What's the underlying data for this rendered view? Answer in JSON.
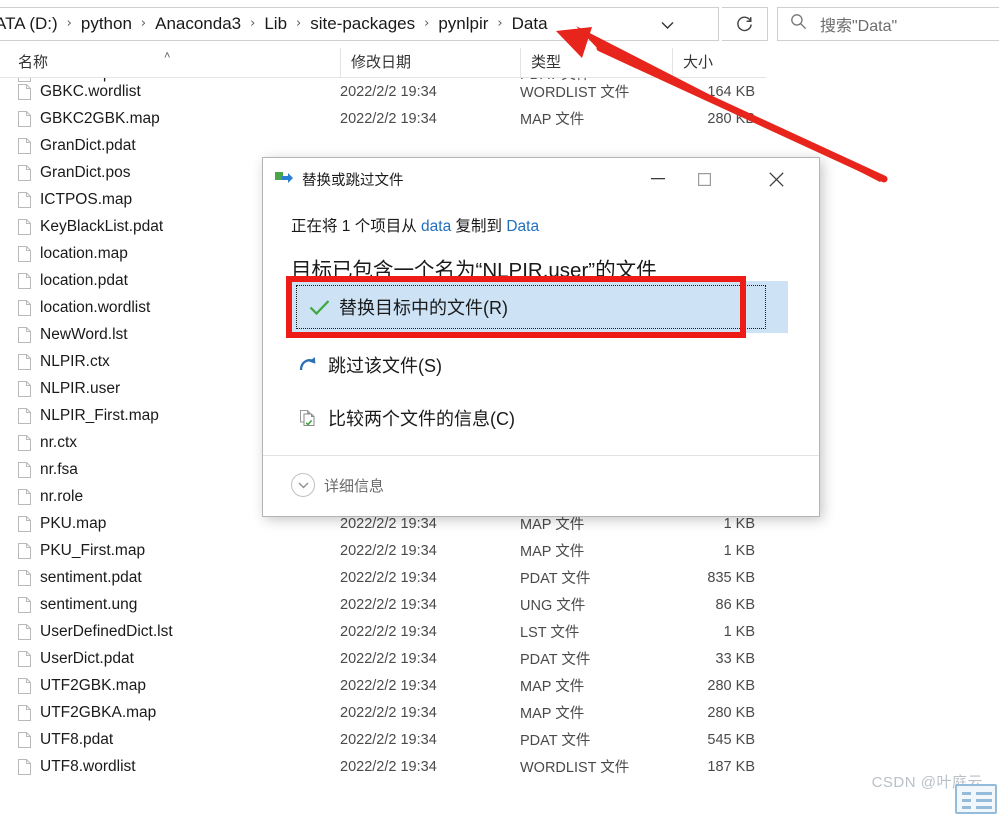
{
  "window": {
    "breadcrumb": {
      "crumbs": [
        "ATA (D:)",
        "python",
        "Anaconda3",
        "Lib",
        "site-packages",
        "pynlpir",
        "Data"
      ],
      "separator": "›",
      "dropdown_icon": "chevron-down-icon",
      "refresh_icon": "refresh-icon"
    },
    "search": {
      "icon": "search-icon",
      "placeholder": "搜索\"Data\""
    },
    "columns": [
      {
        "label": "名称",
        "sorted": true,
        "sort_caret": "˄"
      },
      {
        "label": "修改日期"
      },
      {
        "label": "类型"
      },
      {
        "label": "大小"
      }
    ]
  },
  "files": [
    {
      "name": "GBKC.wordlist",
      "date": "2022/2/2 19:34",
      "type": "WORDLIST 文件",
      "size": "164 KB"
    },
    {
      "name": "GBKC2GBK.map",
      "date": "2022/2/2 19:34",
      "type": "MAP 文件",
      "size": "280 KB"
    },
    {
      "name": "GranDict.pdat",
      "date": "",
      "type": "",
      "size": ""
    },
    {
      "name": "GranDict.pos",
      "date": "",
      "type": "",
      "size": ""
    },
    {
      "name": "ICTPOS.map",
      "date": "",
      "type": "",
      "size": ""
    },
    {
      "name": "KeyBlackList.pdat",
      "date": "",
      "type": "",
      "size": ""
    },
    {
      "name": "location.map",
      "date": "",
      "type": "",
      "size": ""
    },
    {
      "name": "location.pdat",
      "date": "",
      "type": "",
      "size": ""
    },
    {
      "name": "location.wordlist",
      "date": "",
      "type": "",
      "size": ""
    },
    {
      "name": "NewWord.lst",
      "date": "",
      "type": "",
      "size": ""
    },
    {
      "name": "NLPIR.ctx",
      "date": "",
      "type": "",
      "size": ""
    },
    {
      "name": "NLPIR.user",
      "date": "",
      "type": "",
      "size": ""
    },
    {
      "name": "NLPIR_First.map",
      "date": "",
      "type": "",
      "size": ""
    },
    {
      "name": "nr.ctx",
      "date": "",
      "type": "",
      "size": ""
    },
    {
      "name": "nr.fsa",
      "date": "",
      "type": "",
      "size": ""
    },
    {
      "name": "nr.role",
      "date": "",
      "type": "",
      "size": ""
    },
    {
      "name": "PKU.map",
      "date": "2022/2/2 19:34",
      "type": "MAP 文件",
      "size": "1 KB"
    },
    {
      "name": "PKU_First.map",
      "date": "2022/2/2 19:34",
      "type": "MAP 文件",
      "size": "1 KB"
    },
    {
      "name": "sentiment.pdat",
      "date": "2022/2/2 19:34",
      "type": "PDAT 文件",
      "size": "835 KB"
    },
    {
      "name": "sentiment.ung",
      "date": "2022/2/2 19:34",
      "type": "UNG 文件",
      "size": "86 KB"
    },
    {
      "name": "UserDefinedDict.lst",
      "date": "2022/2/2 19:34",
      "type": "LST 文件",
      "size": "1 KB"
    },
    {
      "name": "UserDict.pdat",
      "date": "2022/2/2 19:34",
      "type": "PDAT 文件",
      "size": "33 KB"
    },
    {
      "name": "UTF2GBK.map",
      "date": "2022/2/2 19:34",
      "type": "MAP 文件",
      "size": "280 KB"
    },
    {
      "name": "UTF2GBKA.map",
      "date": "2022/2/2 19:34",
      "type": "MAP 文件",
      "size": "280 KB"
    },
    {
      "name": "UTF8.pdat",
      "date": "2022/2/2 19:34",
      "type": "PDAT 文件",
      "size": "545 KB"
    },
    {
      "name": "UTF8.wordlist",
      "date": "2022/2/2 19:34",
      "type": "WORDLIST 文件",
      "size": "187 KB"
    }
  ],
  "dialog": {
    "icon": "copy-file-icon",
    "title": "替换或跳过文件",
    "minimize_label": "─",
    "maximize_label": "□",
    "close_label": "✕",
    "subtitle_prefix": "正在将 1 个项目从 ",
    "subtitle_source": "data",
    "subtitle_middle": " 复制到 ",
    "subtitle_target": "Data",
    "heading": "目标已包含一个名为“NLPIR.user”的文件",
    "options": [
      {
        "id": "replace",
        "icon": "check-icon",
        "label": "替换目标中的文件(R)",
        "selected": true
      },
      {
        "id": "skip",
        "icon": "skip-arrow-icon",
        "label": "跳过该文件(S)",
        "selected": false
      },
      {
        "id": "compare",
        "icon": "compare-files-icon",
        "label": "比较两个文件的信息(C)",
        "selected": false
      }
    ],
    "details": {
      "icon": "chevron-down-circle-icon",
      "label": "详细信息"
    }
  },
  "annotations": {
    "arrow_color": "#e8251c",
    "highlight_box_color": "#ee1c16"
  },
  "watermark": {
    "text": "CSDN @叶庭云"
  },
  "colors": {
    "accent_blue": "#1f6fbf",
    "selection_bg": "#cde3f5",
    "check_green": "#3ba93b",
    "annotation_red": "#ee1c16"
  }
}
